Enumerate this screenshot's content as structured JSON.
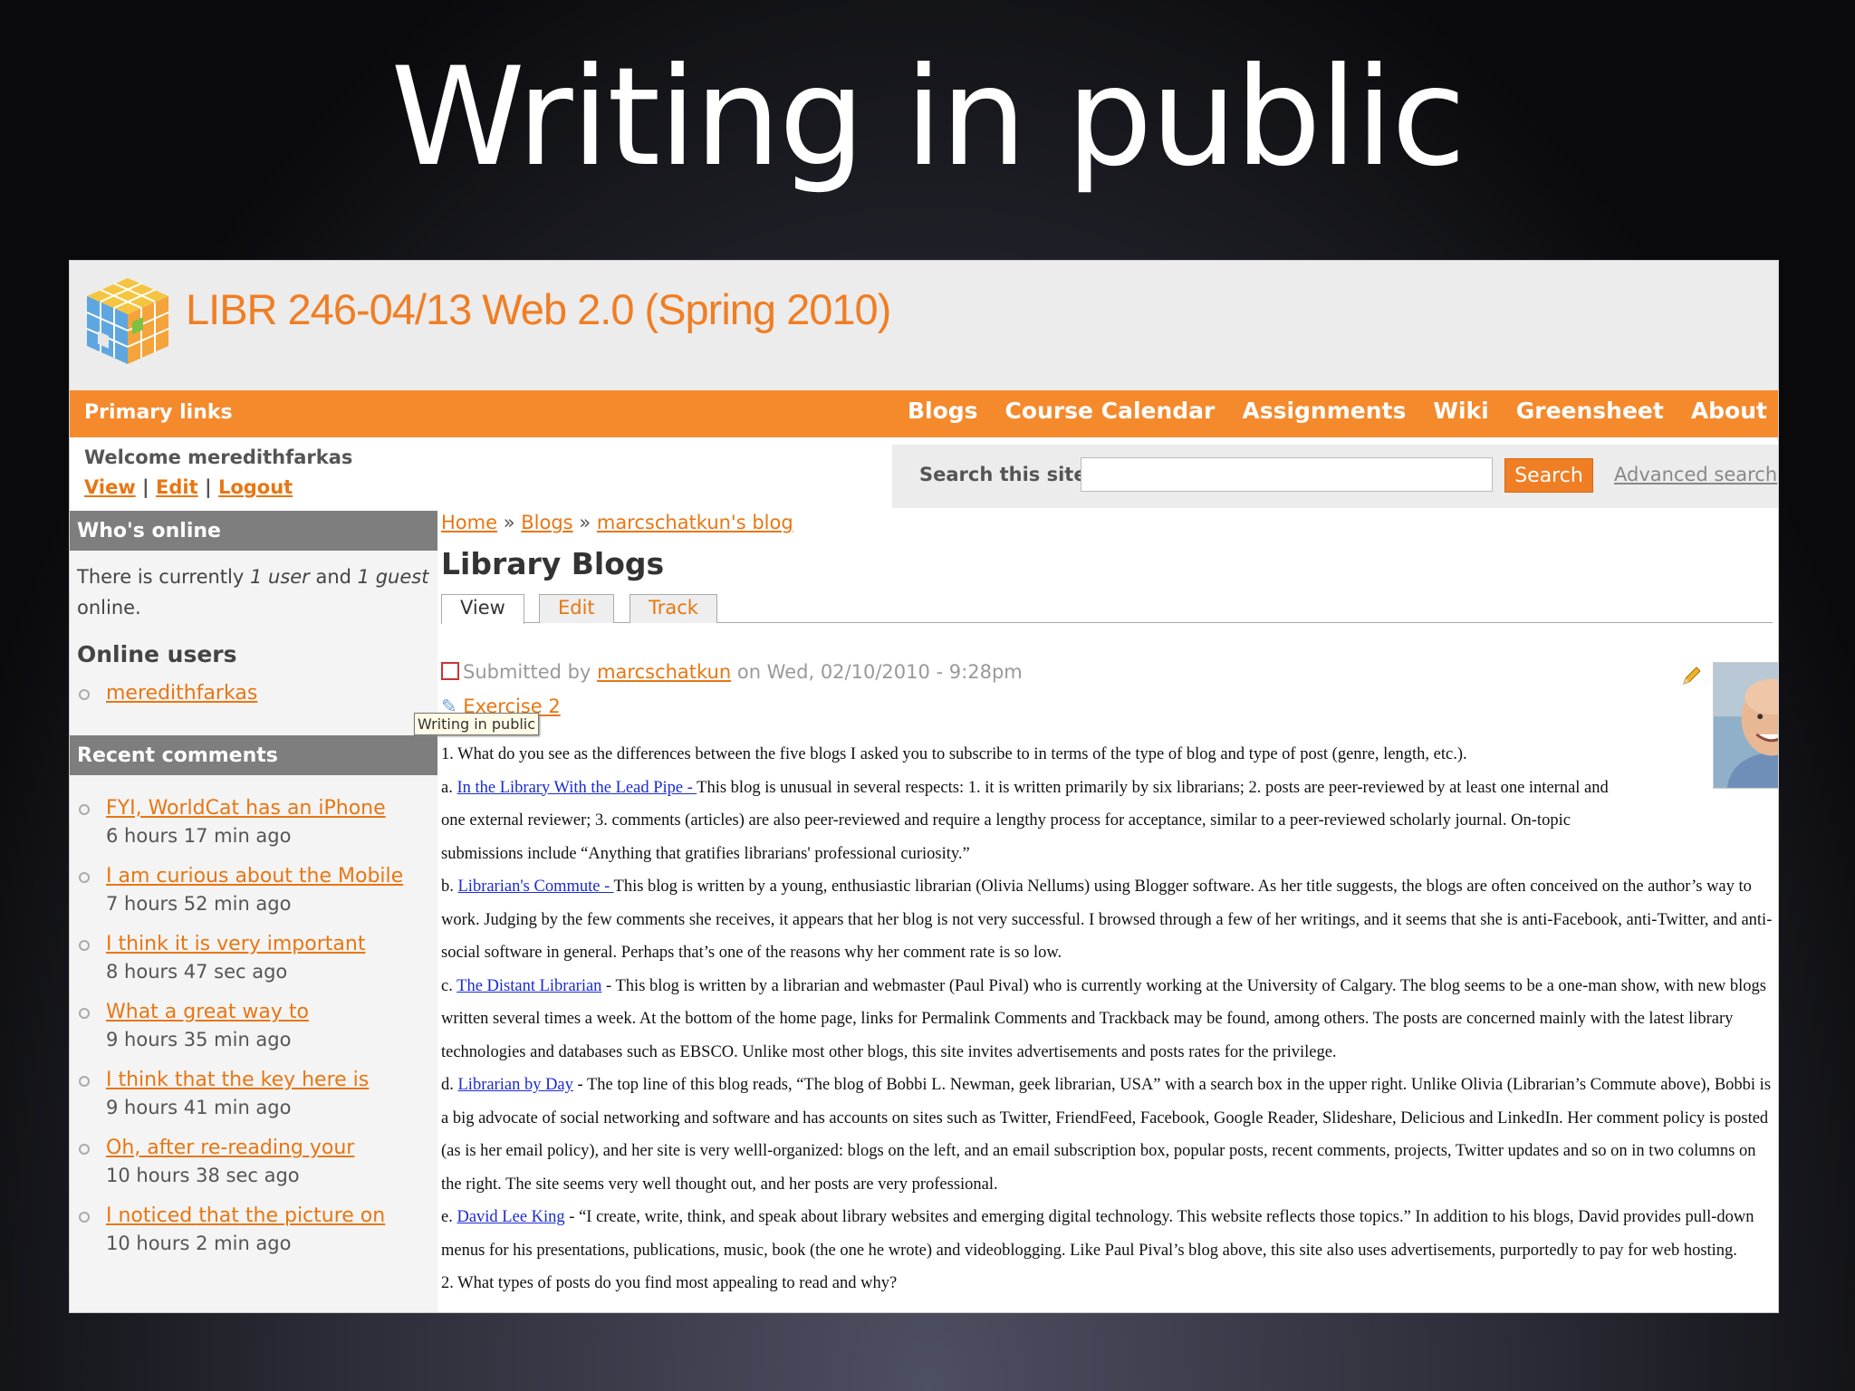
{
  "slide": {
    "title": "Writing in public"
  },
  "site": {
    "name": "LIBR 246-04/13 Web 2.0 (Spring 2010)",
    "primary_label": "Primary links",
    "nav": [
      "Blogs",
      "Course Calendar",
      "Assignments",
      "Wiki",
      "Greensheet",
      "About"
    ],
    "welcome": "Welcome meredithfarkas",
    "user_links": [
      "View",
      "Edit",
      "Logout"
    ],
    "search": {
      "label": "Search this site:",
      "value": "",
      "button": "Search",
      "advanced": "Advanced search"
    }
  },
  "sidebar": {
    "whos_online_title": "Who's online",
    "online_text": {
      "prefix": "There is currently ",
      "users": "1 user",
      "middle": " and ",
      "guests": "1 guest",
      "suffix": " online."
    },
    "online_users_title": "Online users",
    "online_users": [
      "meredithfarkas"
    ],
    "recent_title": "Recent comments",
    "recent_comments": [
      {
        "title": "FYI, WorldCat has an iPhone",
        "ago": "6 hours 17 min ago"
      },
      {
        "title": "I am curious about the Mobile",
        "ago": "7 hours 52 min ago"
      },
      {
        "title": "I think it is very important",
        "ago": "8 hours 47 sec ago"
      },
      {
        "title": "What a great way  to",
        "ago": "9 hours 35 min ago"
      },
      {
        "title": "I think that the key here is",
        "ago": "9 hours 41 min ago"
      },
      {
        "title": "Oh, after re-reading your",
        "ago": "10 hours 38 sec ago"
      },
      {
        "title": "I noticed that the picture on",
        "ago": "10 hours 2 min ago"
      }
    ]
  },
  "content": {
    "breadcrumb": [
      "Home",
      "Blogs",
      "marcschatkun's blog"
    ],
    "breadcrumb_sep": "»",
    "page_title": "Library Blogs",
    "tabs": [
      "View",
      "Edit",
      "Track"
    ],
    "meta": {
      "prefix": "Submitted by ",
      "author": "marcschatkun",
      "suffix": " on Wed, 02/10/2010 - 9:28pm"
    },
    "exercise": "Exercise 2",
    "tooltip": "Writing in public",
    "q1": "1. What do you see as the differences between the five blogs I asked you to subscribe to in terms of the type of blog and type of post (genre, length, etc.).",
    "a": {
      "label": "a. ",
      "link": "In the Library With the Lead Pipe  - ",
      "text": " This blog is unusual in several respects: 1. it is written primarily by six librarians; 2. posts are peer-reviewed by at least one internal and one external reviewer; 3. comments (articles) are also peer-reviewed and require a lengthy process for acceptance, similar to a peer-reviewed scholarly journal. On-topic submissions include “Anything that gratifies librarians' professional curiosity.”"
    },
    "b": {
      "label": "b. ",
      "link": "Librarian's Commute  - ",
      "text": " This blog is written by a young, enthusiastic librarian (Olivia Nellums) using Blogger software. As her title suggests, the blogs are often conceived on the author’s way to work. Judging by the few comments she receives, it appears that her blog is not very successful. I browsed through a few of her writings, and it seems that she is anti-Facebook, anti-Twitter, and anti-social software in general. Perhaps that’s one of the reasons why her comment rate is so low."
    },
    "c": {
      "label": "c. ",
      "link": "The Distant Librarian",
      "text": "  -  This blog is written by a librarian and webmaster (Paul Pival) who is currently working at the University of Calgary. The blog seems to be a one-man show, with new blogs written several times a week. At the bottom of the home page, links for Permalink Comments and Trackback may be found, among others. The posts are concerned mainly with the latest library technologies and databases such as EBSCO. Unlike most other blogs, this site invites advertisements and posts rates for the privilege."
    },
    "d": {
      "label": "d. ",
      "link": "Librarian by Day",
      "text": "  -  The top line of this blog reads, “The blog of Bobbi L. Newman, geek librarian, USA” with a search box in the upper right. Unlike Olivia (Librarian’s Commute above), Bobbi is a big advocate of social networking and software and has accounts on sites such as Twitter, FriendFeed, Facebook, Google Reader, Slideshare, Delicious and LinkedIn. Her comment policy is posted (as is her email policy), and her site is very welll-organized: blogs on the left, and an email subscription box, popular posts, recent comments, projects, Twitter updates and so on in two columns on the right. The site seems very well thought out, and her posts are very professional."
    },
    "e": {
      "label": "e. ",
      "link": "David Lee King",
      "text": "  -  “I create, write, think, and speak about library websites and emerging digital technology. This website reflects those topics.” In addition to his blogs, David provides pull-down menus for his presentations, publications, music, book (the one he wrote) and videoblogging. Like Paul Pival’s blog above, this site also uses advertisements, purportedly to pay for web hosting."
    },
    "q2": "2. What types of posts do you find most appealing to read and why?"
  },
  "colors": {
    "accent": "#f58a2d",
    "link_orange": "#e87612",
    "sidebar_title": "#7e7e7e",
    "body_link": "#1a2bd0"
  }
}
